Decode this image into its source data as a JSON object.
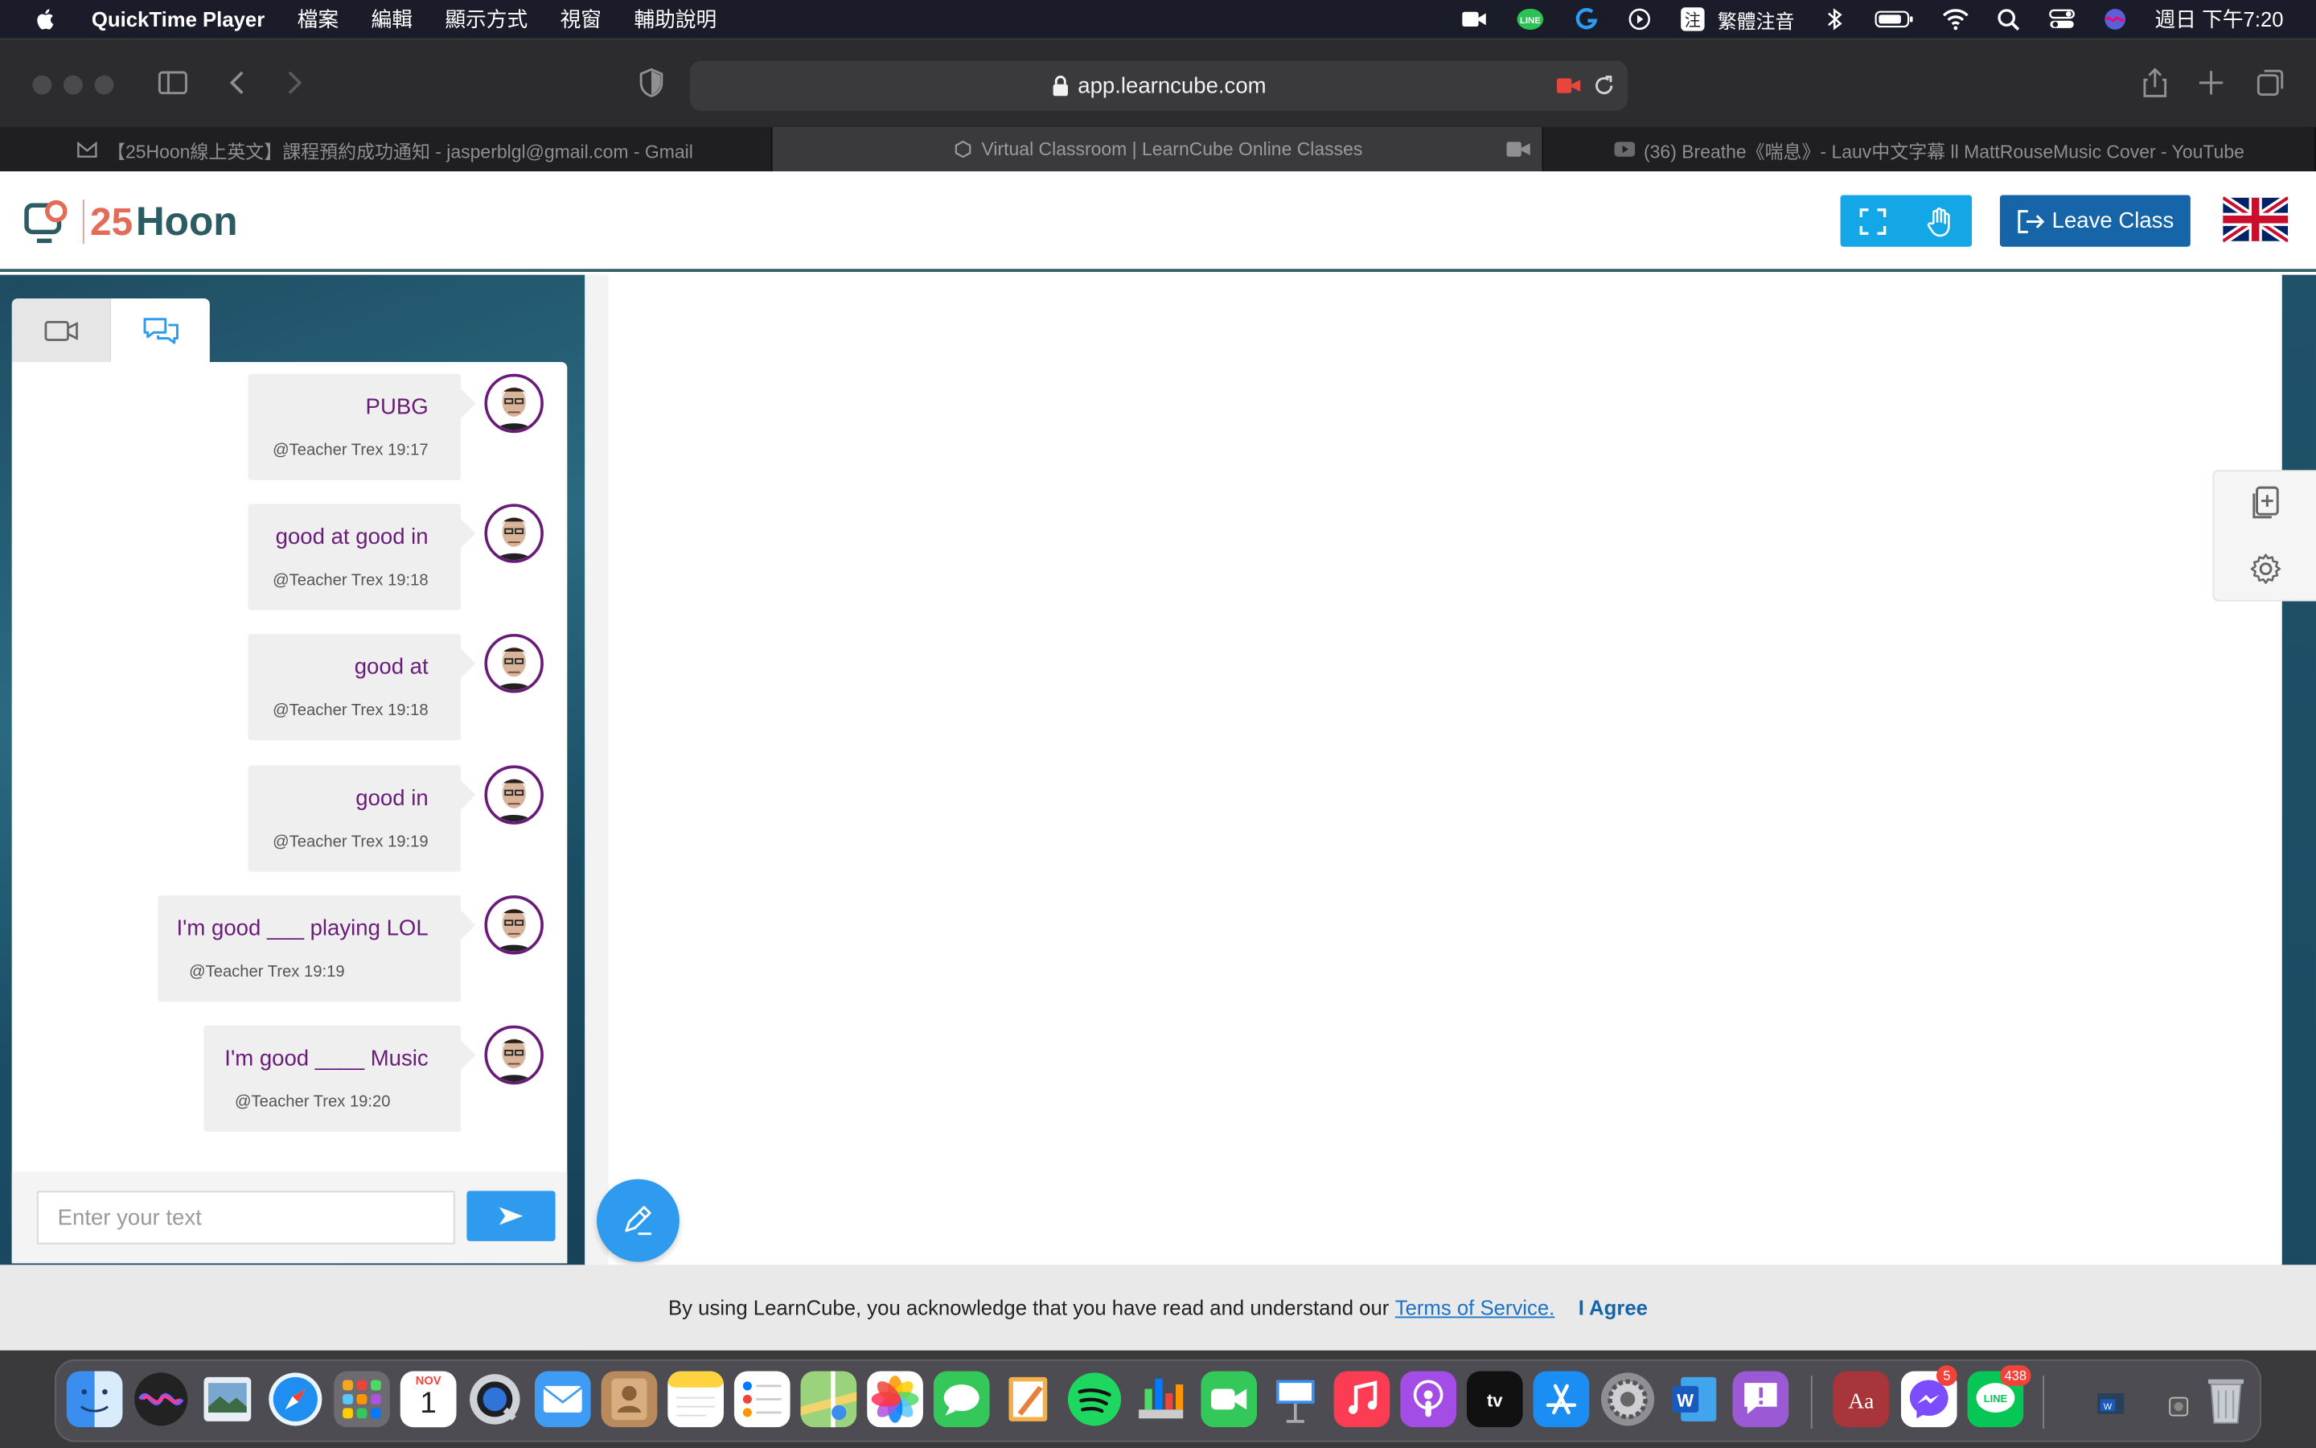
{
  "menubar": {
    "app_name": "QuickTime Player",
    "menus": [
      "檔案",
      "編輯",
      "顯示方式",
      "視窗",
      "輔助說明"
    ],
    "input_method": "繁體注音",
    "clock": "週日 下午7:20"
  },
  "browser": {
    "url": "app.learncube.com",
    "tabs": [
      {
        "title": "【25Hoon線上英文】課程預約成功通知 - jasperblgl@gmail.com - Gmail",
        "active": false
      },
      {
        "title": "Virtual Classroom | LearnCube Online Classes",
        "active": true
      },
      {
        "title": "(36) Breathe《喘息》- Lauv中文字幕 ll MattRouseMusic Cover - YouTube",
        "active": false
      }
    ]
  },
  "header": {
    "logo_number": "25",
    "logo_word": "Hoon",
    "leave_label": "Leave Class"
  },
  "chat": {
    "messages": [
      {
        "text": "PUBG",
        "meta": "@Teacher Trex 19:17"
      },
      {
        "text": "good at good in",
        "meta": "@Teacher Trex 19:18"
      },
      {
        "text": "good at",
        "meta": "@Teacher Trex 19:18"
      },
      {
        "text": "good in",
        "meta": "@Teacher Trex 19:19"
      },
      {
        "text": "I'm good ___ playing LOL",
        "meta": "@Teacher Trex 19:19"
      },
      {
        "text": "I'm good ____ Music",
        "meta": "@Teacher Trex 19:20"
      }
    ],
    "input_placeholder": "Enter your text"
  },
  "consent": {
    "text": "By using LearnCube, you acknowledge that you have read and understand our",
    "link": "Terms of Service.",
    "agree": "I Agree"
  },
  "dock": {
    "calendar_month": "NOV",
    "calendar_day": "1",
    "messenger_badge": "5",
    "line_badge": "438"
  },
  "colors": {
    "accent_blue": "#13a7e8",
    "leave_blue": "#1565a8",
    "chat_text": "#6a1b7a",
    "logo_coral": "#e36b57",
    "logo_teal": "#2b5c62"
  }
}
